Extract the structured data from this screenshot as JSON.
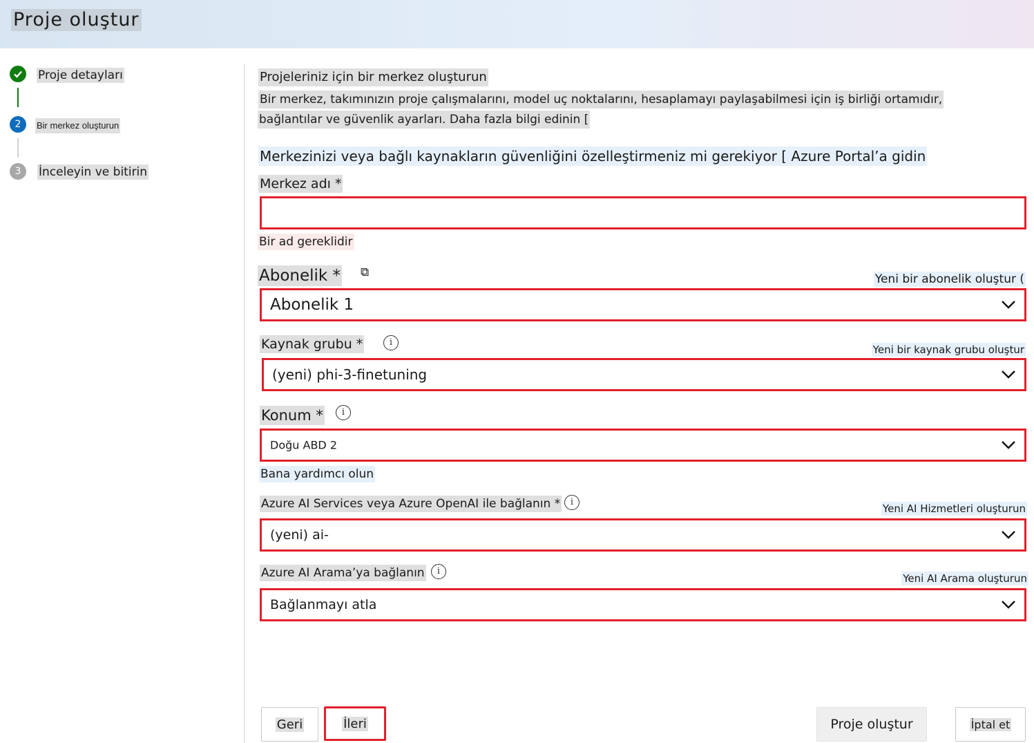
{
  "header": {
    "title": "Proje oluştur"
  },
  "steps": [
    {
      "number": "",
      "label": "Proje detayları",
      "status": "completed"
    },
    {
      "number": "2",
      "label": "Bir merkez oluşturun",
      "status": "active"
    },
    {
      "number": "3",
      "label": "İnceleyin ve bitirin",
      "status": "pending"
    }
  ],
  "section": {
    "title": "Projeleriniz için bir merkez oluşturun",
    "description_line1": "Bir merkez, takımınızın proje çalışmalarını, model uç noktalarını, hesaplamayı paylaşabilmesi için iş birliği ortamıdır,",
    "description_line2": "bağlantılar ve güvenlik ayarları. Daha fazla bilgi edinin [",
    "security_note": "Merkezinizi veya bağlı kaynakların güvenliğini özelleştirmeniz mi gerekiyor [ Azure Portal’a gidin"
  },
  "form": {
    "hub_name": {
      "label": "Merkez adı *",
      "value": "",
      "error": "Bir ad gereklidir"
    },
    "subscription": {
      "label": "Abonelik *",
      "value": "Abonelik 1",
      "create_link": "Yeni bir abonelik oluştur ("
    },
    "resource_group": {
      "label": "Kaynak grubu *",
      "value": "(yeni) phi-3-finetuning",
      "create_link": "Yeni bir kaynak grubu oluştur"
    },
    "location": {
      "label": "Konum *",
      "value": "Doğu ABD 2",
      "help_link": "Bana yardımcı olun"
    },
    "ai_services": {
      "label": "Azure AI Services veya Azure OpenAI ile bağlanın *",
      "value": "(yeni) ai-",
      "create_link": "Yeni AI Hizmetleri oluşturun"
    },
    "ai_search": {
      "label": "Azure AI Arama’ya bağlanın",
      "value": "Bağlanmayı atla",
      "create_link": "Yeni AI Arama oluşturun"
    }
  },
  "footer": {
    "back": "Geri",
    "next": "İleri",
    "create": "Proje oluştur",
    "cancel": "İptal et"
  },
  "colors": {
    "accent": "#0f6cbd",
    "error_border": "#e2202b",
    "success": "#107c10"
  }
}
